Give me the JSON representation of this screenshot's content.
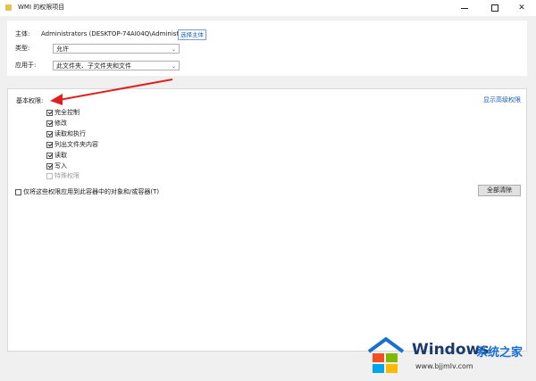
{
  "window": {
    "title": "WMI 的权限项目"
  },
  "principal": {
    "label": "主体:",
    "value": "Administrators (DESKTOP-74AI04Q\\Administrators)",
    "select_label": "选择主体"
  },
  "type": {
    "label": "类型:",
    "value": "允许"
  },
  "applies_to": {
    "label": "应用于:",
    "value": "此文件夹、子文件夹和文件"
  },
  "basic": {
    "label": "基本权限:",
    "advanced_link": "显示高级权限",
    "permissions": [
      {
        "label": "完全控制",
        "checked": true,
        "disabled": false
      },
      {
        "label": "修改",
        "checked": true,
        "disabled": false
      },
      {
        "label": "读取和执行",
        "checked": true,
        "disabled": false
      },
      {
        "label": "列出文件夹内容",
        "checked": true,
        "disabled": false
      },
      {
        "label": "读取",
        "checked": true,
        "disabled": false
      },
      {
        "label": "写入",
        "checked": true,
        "disabled": false
      },
      {
        "label": "特殊权限",
        "checked": false,
        "disabled": true
      }
    ],
    "apply_only_label": "仅将这些权限应用到此容器中的对象和/或容器(T)",
    "clear_all_label": "全部清除"
  },
  "watermark": {
    "brand": "Windows",
    "brand_cn": "系统之家",
    "url": "www.bjjmlv.com"
  },
  "colors": {
    "arrow": "#e02020",
    "link": "#1a5fb4",
    "logo_blue": "#1a6fd0"
  }
}
